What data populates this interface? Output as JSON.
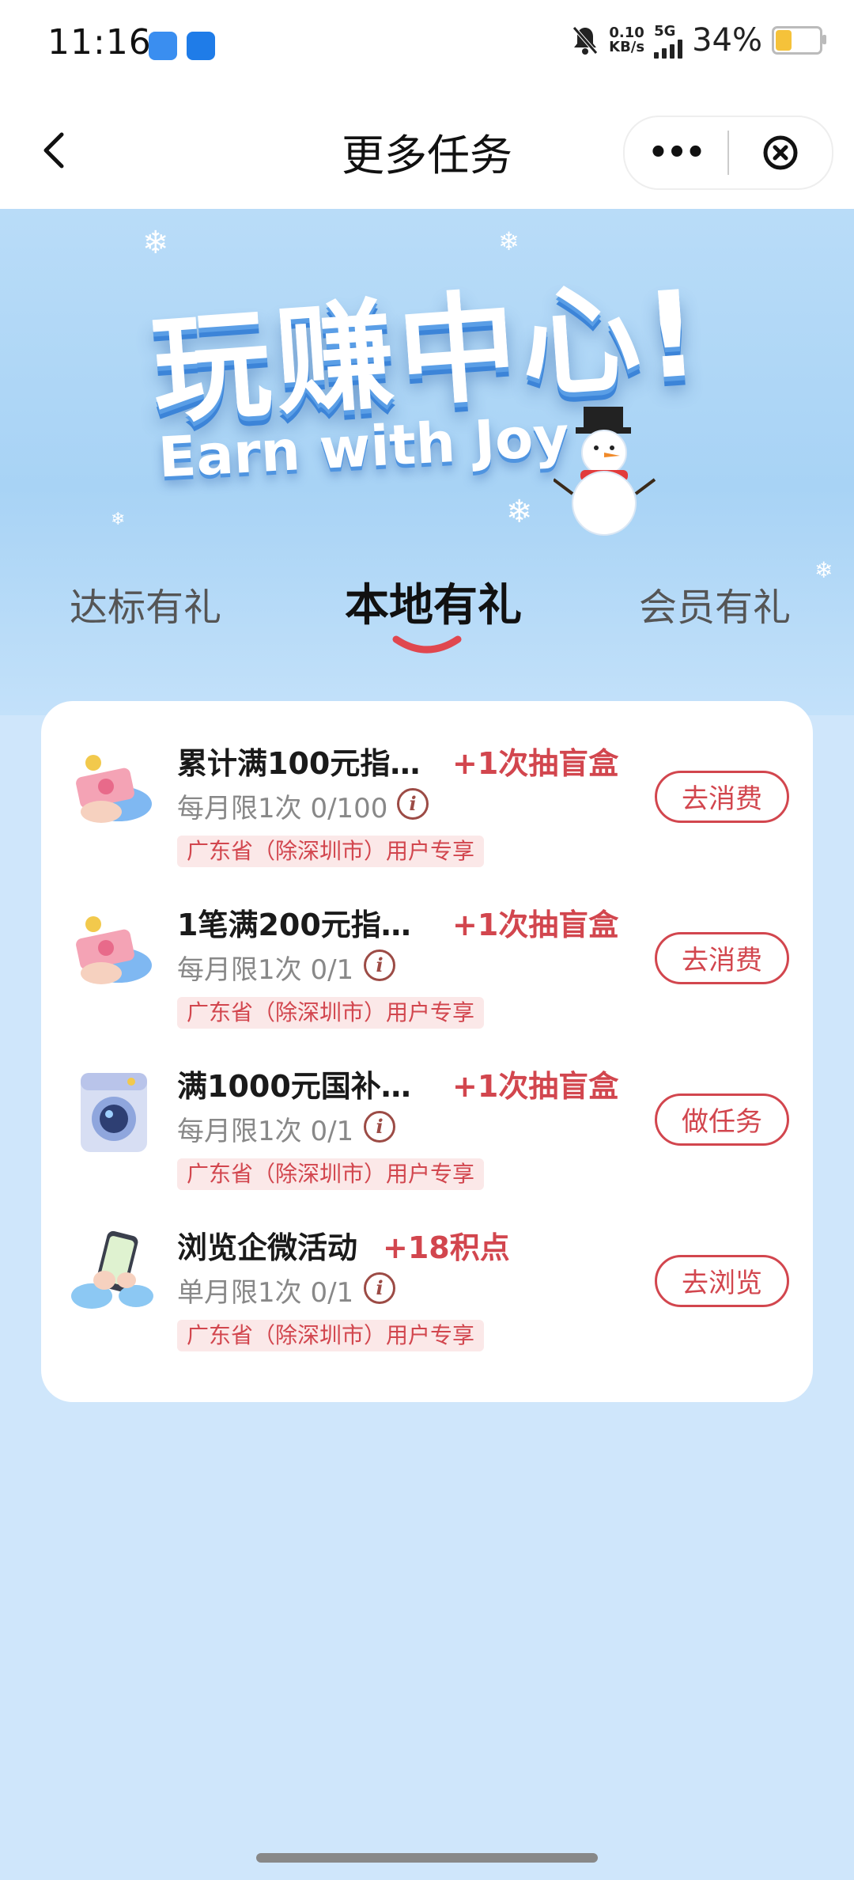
{
  "status_bar": {
    "time": "11:16",
    "net_speed_value": "0.10",
    "net_speed_unit": "KB/s",
    "network": "5G",
    "battery": "34%"
  },
  "nav": {
    "title": "更多任务",
    "more_label": "•••"
  },
  "hero": {
    "title": "玩赚中心!",
    "subtitle": "Earn with Joy"
  },
  "tabs": [
    {
      "label": "达标有礼",
      "active": false
    },
    {
      "label": "本地有礼",
      "active": true
    },
    {
      "label": "会员有礼",
      "active": false
    }
  ],
  "tasks": [
    {
      "icon": "cash-hand-icon",
      "title": "累计满100元指…",
      "reward": "+1次抽盲盒",
      "limit": "每月限1次  0/100",
      "tag": "广东省（除深圳市）用户专享",
      "button": "去消费"
    },
    {
      "icon": "cash-hand-icon",
      "title": "1笔满200元指…",
      "reward": "+1次抽盲盒",
      "limit": "每月限1次  0/1",
      "tag": "广东省（除深圳市）用户专享",
      "button": "去消费"
    },
    {
      "icon": "washing-machine-icon",
      "title": "满1000元国补…",
      "reward": "+1次抽盲盒",
      "limit": "每月限1次  0/1",
      "tag": "广东省（除深圳市）用户专享",
      "button": "做任务"
    },
    {
      "icon": "phone-hand-icon",
      "title": "浏览企微活动",
      "reward": "+18积点",
      "limit": "单月限1次  0/1",
      "tag": "广东省（除深圳市）用户专享",
      "button": "去浏览"
    }
  ],
  "colors": {
    "accent_red": "#d2464e",
    "background": "#cfe6fb"
  }
}
